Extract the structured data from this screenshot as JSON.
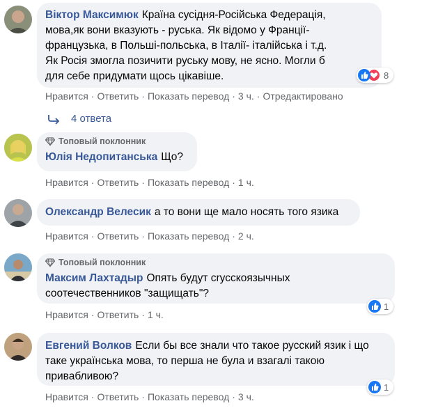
{
  "comments": [
    {
      "author": "Віктор Максимюк",
      "lines": [
        "Країна сусідня-Російська Федерація,",
        "мова,як вони вказують - руська. Як відомо у Франції-",
        "французька, в Польші-польська, в Італії- італійська і т.д.",
        "Як Росія змогла позичити руську мову, не ясно. Могли б",
        "для себе придумати щось цікавіше."
      ],
      "reaction_count": "8",
      "actions": {
        "like": "Нравится",
        "reply": "Ответить",
        "translate": "Показать перевод",
        "time": "3 ч.",
        "edited": "Отредактировано"
      },
      "replies_label": "4 ответа"
    },
    {
      "badge": "Топовый поклонник",
      "author": "Юлія Недопитанська",
      "text": "Що?",
      "actions": {
        "like": "Нравится",
        "reply": "Ответить",
        "translate": "Показать перевод",
        "time": "1 ч."
      }
    },
    {
      "author": "Олександр Велесик",
      "text": "а то вони ще мало носять того язика",
      "actions": {
        "like": "Нравится",
        "reply": "Ответить",
        "translate": "Показать перевод",
        "time": "2 ч."
      }
    },
    {
      "badge": "Топовый поклонник",
      "author": "Максим Лахтадыр",
      "lines": [
        "Опять будут сrусскоязычных",
        "соотечественников \"защищать\"?"
      ],
      "reaction_count": "1",
      "actions": {
        "like": "Нравится",
        "reply": "Ответить",
        "time": "1 ч."
      }
    },
    {
      "author": "Евгений Волков",
      "lines": [
        "Если бы все знали что такое русский язик і що",
        "таке українська мова, то перша не була и взагалі такою",
        "привабливою?"
      ],
      "reaction_count": "1",
      "actions": {
        "like": "Нравится",
        "reply": "Ответить",
        "translate": "Показать перевод",
        "time": "3 ч."
      }
    }
  ],
  "colors": {
    "link": "#385898",
    "bubble": "#f0f2f5",
    "meta": "#65676b",
    "like": "#1877f2",
    "love": "#f33e58"
  },
  "icons": [
    "diamond-badge-icon",
    "like-reaction-icon",
    "love-reaction-icon",
    "replies-arrow-icon"
  ]
}
